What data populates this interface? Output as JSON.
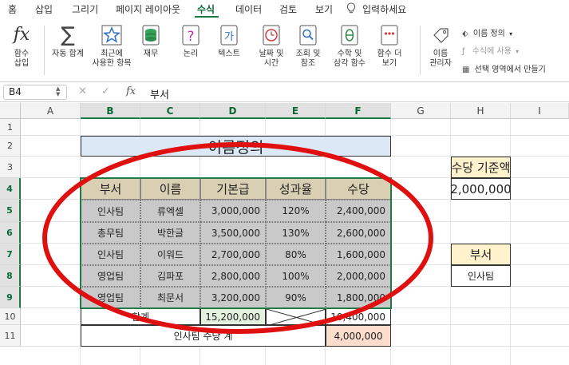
{
  "menu": {
    "items": [
      "홈",
      "삽입",
      "그리기",
      "페이지 레이아웃",
      "수식",
      "데이터",
      "검토",
      "보기"
    ],
    "active": "수식",
    "tell_me": "입력하세요"
  },
  "ribbon": {
    "insert_function": "함수\n삽입",
    "autosum": "자동 합계",
    "recent": "최근에\n사용한 항목",
    "financial": "재무",
    "logical": "논리",
    "text": "텍스트",
    "datetime": "날짜 및\n시간",
    "lookup": "조회 및\n참조",
    "math": "수학 및\n삼각 함수",
    "more": "함수 더\n보기",
    "name_manager": "이름\n관리자",
    "define_name": "이름 정의",
    "use_in_formula": "수식에 사용",
    "create_from_selection": "선택 영역에서 만들기"
  },
  "formula_bar": {
    "name_box": "B4",
    "fx": "fx",
    "formula": "부서"
  },
  "columns": [
    "A",
    "B",
    "C",
    "D",
    "E",
    "F",
    "G",
    "H",
    "I"
  ],
  "rows": [
    "1",
    "2",
    "3",
    "4",
    "5",
    "6",
    "7",
    "8",
    "9",
    "10",
    "11"
  ],
  "sheet": {
    "title": "이름정의",
    "table_headers": [
      "부서",
      "이름",
      "기본급",
      "성과율",
      "수당"
    ],
    "table_rows": [
      [
        "인사팀",
        "류엑셀",
        "3,000,000",
        "120%",
        "2,400,000"
      ],
      [
        "총무팀",
        "박한글",
        "3,500,000",
        "130%",
        "2,600,000"
      ],
      [
        "인사팀",
        "이워드",
        "2,700,000",
        "80%",
        "1,600,000"
      ],
      [
        "영업팀",
        "김파포",
        "2,800,000",
        "100%",
        "2,000,000"
      ],
      [
        "영업팀",
        "최문서",
        "3,200,000",
        "90%",
        "1,800,000"
      ]
    ],
    "total_label": "합계",
    "total_basic": "15,200,000",
    "total_allowance": "10,400,000",
    "dept_total_label": "인사팀 수당 계",
    "dept_total_value": "4,000,000",
    "threshold_label": "수당 기준액",
    "threshold_value": "2,000,000",
    "dept_label": "부서",
    "dept_value": "인사팀"
  },
  "colors": {
    "accent": "#1e7b45",
    "header_fill": "#d9d0b4",
    "data_fill": "#c9c9c9",
    "title_fill": "#dce8f6",
    "annotation": "#e01010"
  }
}
